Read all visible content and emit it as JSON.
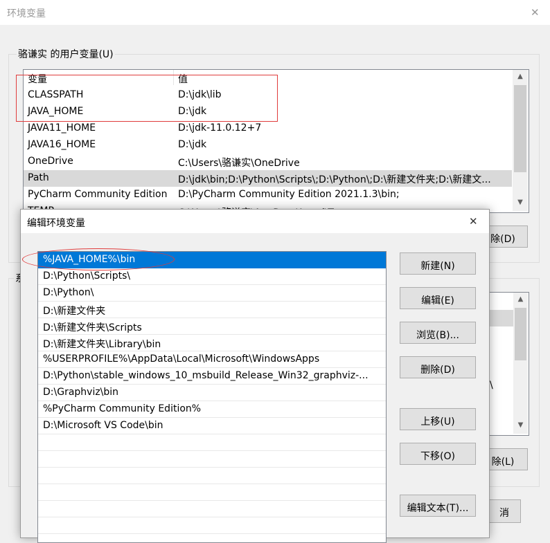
{
  "back_window": {
    "title": "环境变量",
    "user_vars_label": "骆谦实 的用户变量(U)",
    "columns": {
      "name": "变量",
      "value": "值"
    },
    "rows": [
      {
        "name": "CLASSPATH",
        "value": "D:\\jdk\\lib"
      },
      {
        "name": "JAVA_HOME",
        "value": "D:\\jdk"
      },
      {
        "name": "JAVA11_HOME",
        "value": "D:\\jdk-11.0.12+7"
      },
      {
        "name": "JAVA16_HOME",
        "value": "D:\\jdk"
      },
      {
        "name": "OneDrive",
        "value": "C:\\Users\\骆谦实\\OneDrive"
      },
      {
        "name": "Path",
        "value": "D:\\jdk\\bin;D:\\Python\\Scripts\\;D:\\Python\\;D:\\新建文件夹;D:\\新建文..."
      },
      {
        "name": "PyCharm Community Edition",
        "value": "D:\\PyCharm Community Edition 2021.1.3\\bin;"
      },
      {
        "name": "TEMP",
        "value": "C:\\Users\\骆谦实\\AppData\\Local\\Temp"
      }
    ],
    "delete_user_button_partial": "除(D)",
    "system_label_partial": "系",
    "delete_system_button_partial": "除(L)",
    "cancel_button_partial": "消",
    "system_list_partial": "\\"
  },
  "dialog": {
    "title": "编辑环境变量",
    "paths": [
      "%JAVA_HOME%\\bin",
      "D:\\Python\\Scripts\\",
      "D:\\Python\\",
      "D:\\新建文件夹",
      "D:\\新建文件夹\\Scripts",
      "D:\\新建文件夹\\Library\\bin",
      "%USERPROFILE%\\AppData\\Local\\Microsoft\\WindowsApps",
      "D:\\Python\\stable_windows_10_msbuild_Release_Win32_graphviz-...",
      "D:\\Graphviz\\bin",
      "%PyCharm Community Edition%",
      "D:\\Microsoft VS Code\\bin"
    ],
    "buttons": {
      "new": "新建(N)",
      "edit": "编辑(E)",
      "browse": "浏览(B)...",
      "delete": "删除(D)",
      "move_up": "上移(U)",
      "move_down": "下移(O)",
      "edit_text": "编辑文本(T)..."
    }
  },
  "icons": {
    "close": "close-icon",
    "scroll_up": "chevron-up-icon",
    "scroll_down": "chevron-down-icon"
  },
  "colors": {
    "selection": "#0078d7",
    "annotation": "#e03b3b"
  }
}
